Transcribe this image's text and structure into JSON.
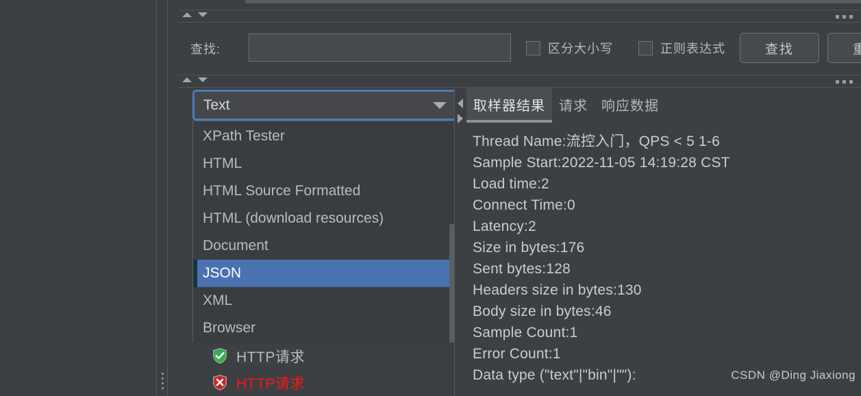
{
  "search": {
    "label": "查找:",
    "value": "",
    "placeholder": "",
    "case_sensitive_label": "区分大小写",
    "regex_label": "正则表达式",
    "find_button": "查找",
    "reset_button": "重置"
  },
  "renderer": {
    "selected": "Text",
    "options": [
      "XPath Tester",
      "HTML",
      "HTML Source Formatted",
      "HTML (download resources)",
      "Document",
      "JSON",
      "XML",
      "Browser"
    ],
    "highlighted": "JSON"
  },
  "tree": {
    "items": [
      {
        "label": "HTTP请求",
        "status": "success"
      },
      {
        "label": "HTTP请求",
        "status": "error"
      }
    ]
  },
  "result": {
    "tabs": [
      {
        "label": "取样器结果",
        "active": true
      },
      {
        "label": "请求",
        "active": false
      },
      {
        "label": "响应数据",
        "active": false
      }
    ],
    "lines": [
      "Thread Name:流控入门，QPS < 5 1-6",
      "Sample Start:2022-11-05 14:19:28 CST",
      "Load time:2",
      "Connect Time:0",
      "Latency:2",
      "Size in bytes:176",
      "Sent bytes:128",
      "Headers size in bytes:130",
      "Body size in bytes:46",
      "Sample Count:1",
      "Error Count:1",
      "Data type (\"text\"|\"bin\"|\"\"):"
    ]
  },
  "watermark": "CSDN @Ding Jiaxiong",
  "colors": {
    "background": "#3c4043",
    "focus_border": "#4a7cb5",
    "selection": "#4b72b0",
    "error_text": "#ff1414",
    "success_icon": "#2cb14a",
    "error_icon": "#cf2222"
  }
}
